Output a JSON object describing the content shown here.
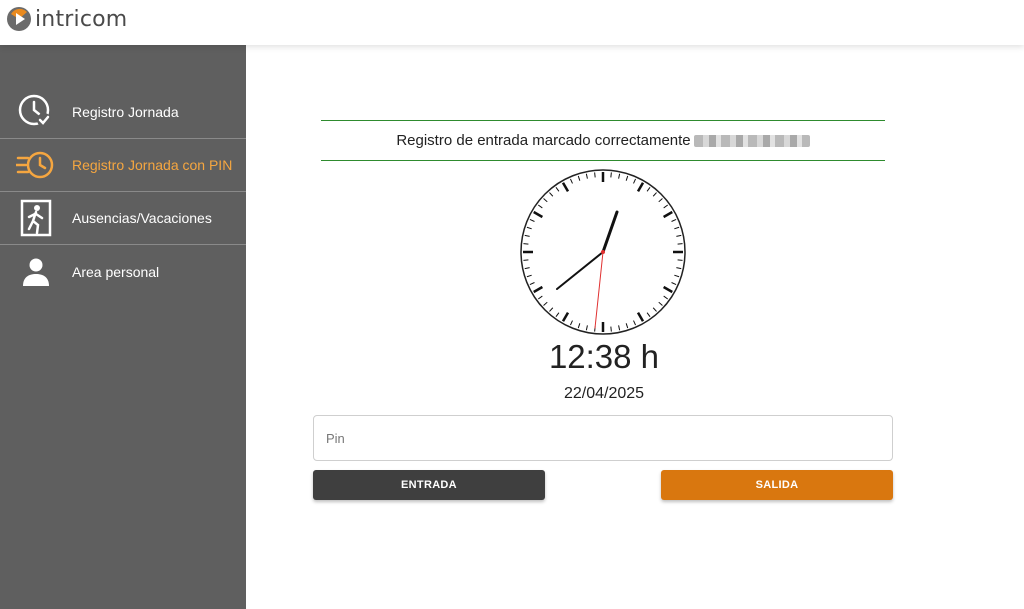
{
  "brand": {
    "name": "intricom"
  },
  "colors": {
    "sidebar_bg": "#5f5f5f",
    "active_accent": "#f5a640",
    "success_line": "#2e8b2e",
    "entrada_button": "#3f3f3f",
    "salida_button": "#d9770f"
  },
  "sidebar": {
    "items": [
      {
        "label": "Registro Jornada",
        "icon": "clock-check-icon",
        "active": false
      },
      {
        "label": "Registro Jornada con PIN",
        "icon": "fast-clock-icon",
        "active": true
      },
      {
        "label": "Ausencias/Vacaciones",
        "icon": "exit-door-icon",
        "active": false
      },
      {
        "label": "Area personal",
        "icon": "person-icon",
        "active": false
      }
    ]
  },
  "main": {
    "message": "Registro de entrada marcado correctamente",
    "time": "12:38 h",
    "date": "22/04/2025",
    "pin_placeholder": "Pin",
    "entrada_label": "ENTRADA",
    "salida_label": "SALIDA"
  }
}
